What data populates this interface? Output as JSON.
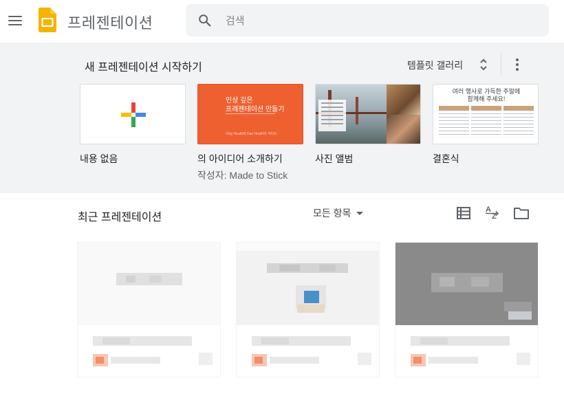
{
  "header": {
    "app_title": "프레젠테이션",
    "menu_icon": "hamburger-menu-icon",
    "logo_icon": "slides-logo-icon",
    "search": {
      "placeholder": "검색",
      "value": "",
      "icon": "search-icon"
    }
  },
  "gallery": {
    "title": "새 프레젠테이션 시작하기",
    "toggle_label": "템플릿 갤러리",
    "toggle_icon": "unfold-more-icon",
    "more_icon": "more-vert-icon",
    "templates": [
      {
        "name": "내용 없음",
        "author": ""
      },
      {
        "name": "의 아이디어 소개하기",
        "author": "작성자: Made to Stick",
        "thumb_line1": "인상 깊은",
        "thumb_line2": "프레젠테이션 만들기",
        "thumb_footer": "Chip Heath와 Dan Heath의 가이드"
      },
      {
        "name": "사진 앨범",
        "author": ""
      },
      {
        "name": "결혼식",
        "author": "",
        "thumb_line1": "여러 행사로 가득한 주말에",
        "thumb_line2": "함께해 주세요!"
      }
    ],
    "colors": {
      "background": "#f1f3f4",
      "pitch_orange": "#ee6030",
      "plus_blue": "#4285f4",
      "plus_red": "#ea4335",
      "plus_yellow": "#fbbc04",
      "plus_green": "#34a853"
    }
  },
  "recent": {
    "title": "최근 프레젠테이션",
    "owner_filter": "모든 항목",
    "icons": [
      "list-view-icon",
      "sort-az-icon",
      "folder-icon"
    ]
  }
}
